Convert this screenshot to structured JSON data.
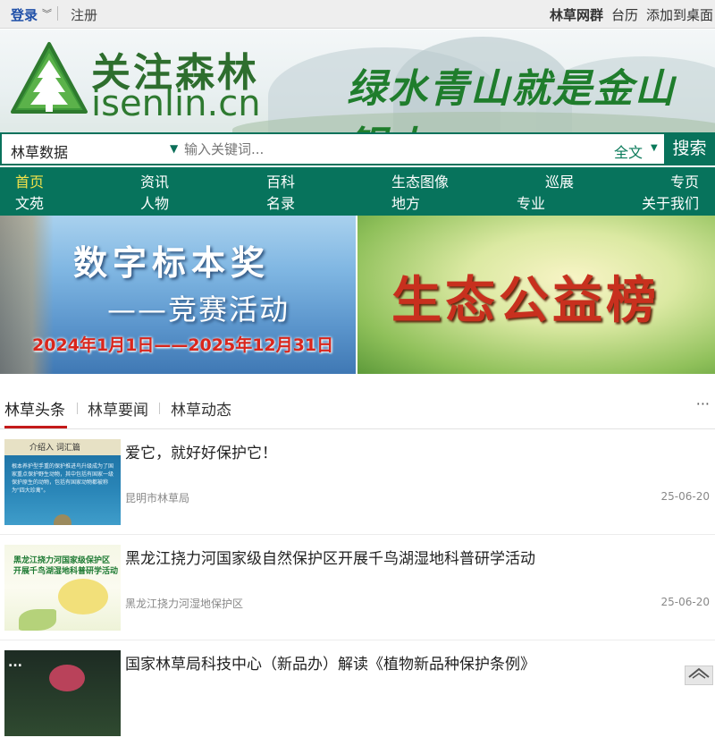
{
  "topbar": {
    "login": "登录",
    "register": "注册",
    "links": [
      "林草网群",
      "台历",
      "添加到桌面"
    ]
  },
  "banner": {
    "brand_cn": "关注森林",
    "brand_en": "isenlin.cn",
    "slogan": "绿水青山就是金山银山"
  },
  "search": {
    "category": "林草数据",
    "placeholder": "输入关键词...",
    "scope": "全文",
    "button": "搜索"
  },
  "nav": {
    "row1": [
      "首页",
      "资讯",
      "百科",
      "生态图像",
      "巡展",
      "专页"
    ],
    "row2": [
      "文苑",
      "人物",
      "名录",
      "地方",
      "专业",
      "关于我们"
    ]
  },
  "promos": {
    "left": {
      "title": "数字标本奖",
      "subtitle": "——竞赛活动",
      "dates": "2024年1月1日——2025年12月31日"
    },
    "right": {
      "title": "生态公益榜"
    }
  },
  "tabs": [
    "林草头条",
    "林草要闻",
    "林草动态"
  ],
  "more_label": "···",
  "news": [
    {
      "title": "爱它，就好好保护它！",
      "source": "昆明市林草局",
      "date": "25-06-20",
      "thumb_header": "介绍入 词汇篇",
      "thumb_text": "根本养护型手重的保护推进鸟升级成为了国家重点保护野生动物，其中包括有国家一级保护原生的动物，包括有国家动物都被称为\"四大珍禽\"。"
    },
    {
      "title": "黑龙江挠力河国家级自然保护区开展千鸟湖湿地科普研学活动",
      "source": "黑龙江挠力河湿地保护区",
      "date": "25-06-20",
      "thumb_lines": [
        "黑龙江挠力河国家级保护区",
        "开展千鸟湖湿地科普研学活动"
      ]
    },
    {
      "title": "国家林草局科技中心（新品办）解读《植物新品种保护条例》",
      "thumb_dots": "..."
    }
  ],
  "backtop_icon": "chevron-up-icon"
}
